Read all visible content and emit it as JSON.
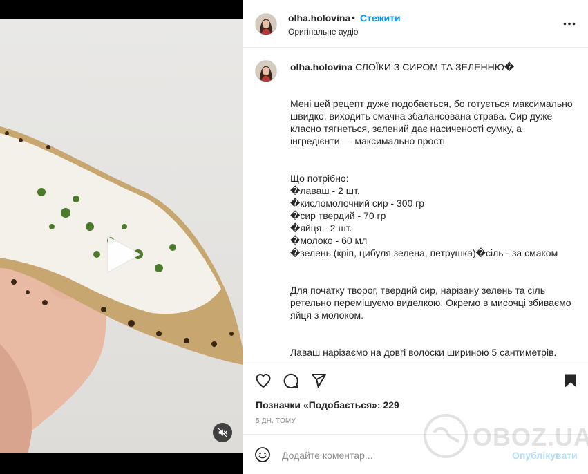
{
  "video": {
    "play_icon": "play-icon",
    "mute_icon": "speaker-muted-icon"
  },
  "header": {
    "username": "olha.holovina",
    "separator": "•",
    "follow_label": "Стежити",
    "audio_label": "Оригінальне аудіо",
    "more_icon": "more-horizontal-icon"
  },
  "caption": {
    "username": "olha.holovina",
    "title": "СЛОЇКИ З СИРОМ ТА ЗЕЛЕННЮ�",
    "paragraphs": [
      "Мені цей рецепт дуже подобається, бо готується максимально швидко, виходить смачна збалансована страва. Сир дуже класно тягнеться, зелений дає насиченості сумку, а інгредієнти — максимально прості",
      "Що потрібно:\n�лаваш - 2 шт.\n�кисломолочний сир - 300 гр\n�сир твердий - 70 гр\n�яйця - 2 шт.\n�молоко - 60 мл\n�зелень (кріп, цибуля зелена, петрушка)�сіль - за смаком",
      "Для початку творог, твердий сир, нарізану зелень та сіль ретельно перемішуємо виделкою. Окремо в мисочці збиваємо яйця з молоком.",
      "Лаваш нарізаємо на довгі волоски шириною 5 сантиметрів. Викладаємо на них начинку та згортаємо так, яке показано на відео. Кожен слоїк обмакуємо в яйці з молоком та смажимо на сковорідці на середньому вогні до золотистого кольору з двох сторін."
    ]
  },
  "actions": {
    "like_icon": "heart-icon",
    "comment_icon": "comment-icon",
    "share_icon": "share-icon",
    "save_icon": "bookmark-icon"
  },
  "likes": "Позначки «Подобається»: 229",
  "time": "5 ДН. ТОМУ",
  "comment": {
    "placeholder": "Додайте коментар...",
    "post_label": "Опублікувати",
    "emoji_icon": "emoji-icon"
  },
  "watermark": {
    "text": "OBOZ.UA"
  },
  "colors": {
    "accent": "#0095f6",
    "post_disabled": "#b2dffc",
    "text": "#262626",
    "muted": "#8e8e8e"
  }
}
